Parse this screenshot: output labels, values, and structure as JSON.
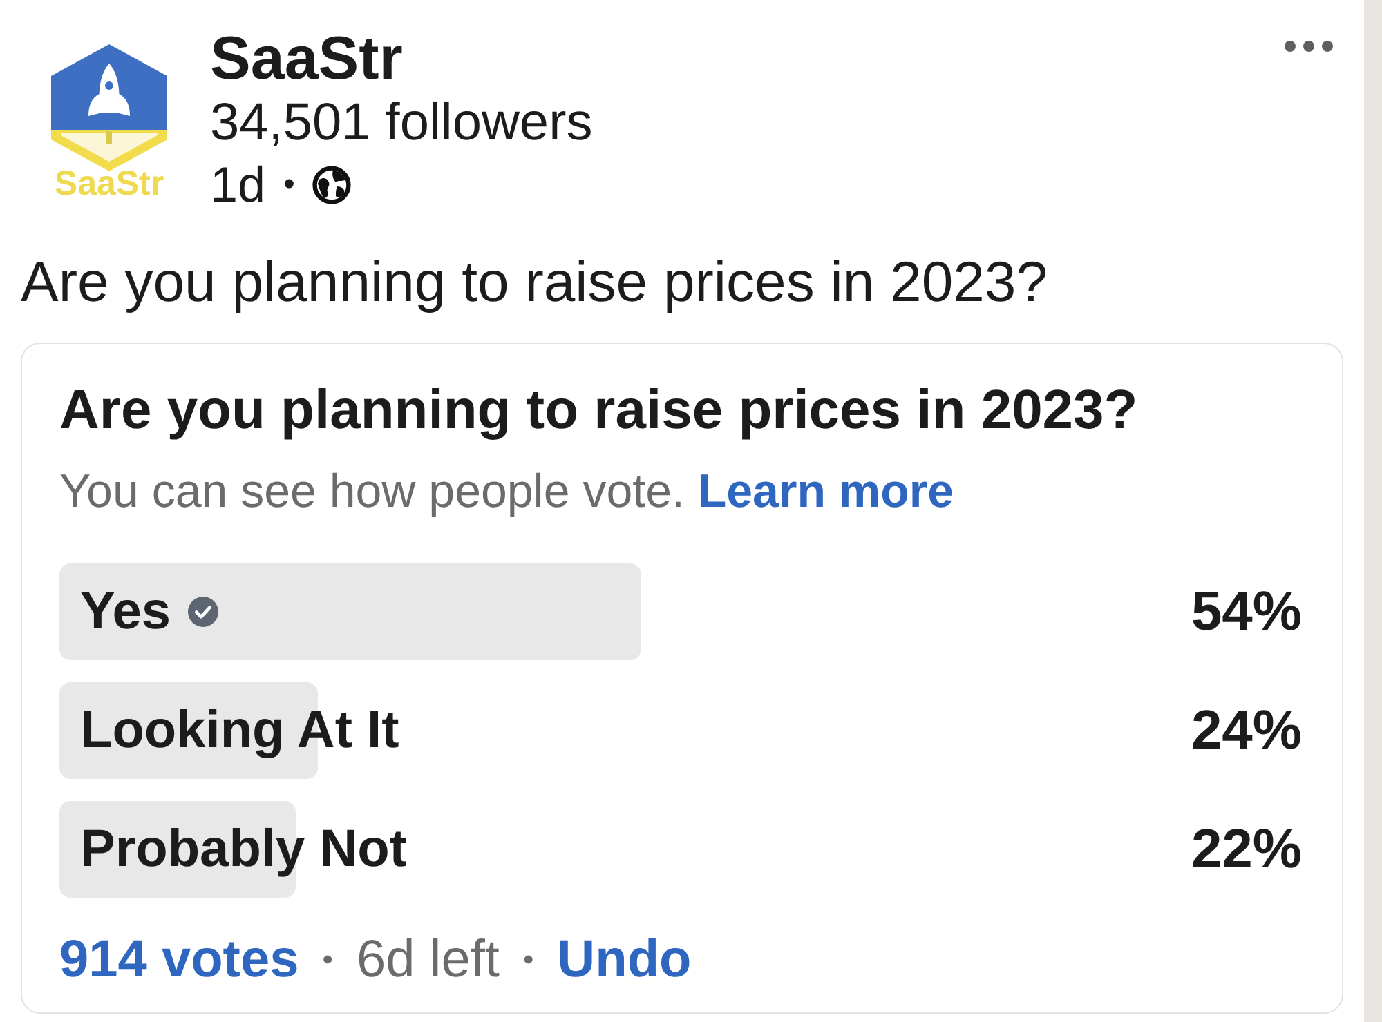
{
  "post": {
    "logo_text": "SaaStr",
    "author": "SaaStr",
    "followers": "34,501 followers",
    "meta": {
      "time": "1d",
      "separator": "•"
    },
    "text": "Are you planning to raise prices in 2023?"
  },
  "poll": {
    "question": "Are you planning to raise prices in 2023?",
    "notice": "You can see how people vote.",
    "learn_more": "Learn more",
    "options": [
      {
        "label": "Yes",
        "selected": true,
        "level": 0.54,
        "percent": "54%"
      },
      {
        "label": "Looking At It",
        "selected": false,
        "level": 0.24,
        "percent": "24%"
      },
      {
        "label": "Probably Not",
        "selected": false,
        "level": 0.22,
        "percent": "22%"
      }
    ],
    "footer": [
      {
        "kind": "link",
        "text": "914 votes"
      },
      {
        "kind": "separator",
        "text": "•"
      },
      {
        "kind": "text",
        "text": "6d left"
      },
      {
        "kind": "separator",
        "text": "•"
      },
      {
        "kind": "link",
        "text": "Undo"
      }
    ]
  }
}
